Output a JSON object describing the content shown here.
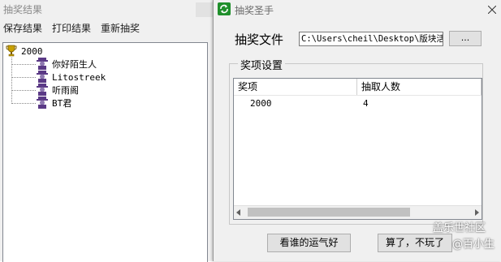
{
  "left_window": {
    "title": "抽奖结果",
    "menu": [
      "保存结果",
      "打印结果",
      "重新抽奖"
    ],
    "tree": {
      "root": "2000",
      "items": [
        "你好陌生人",
        "Litostreek",
        "听雨阁",
        "BT君"
      ]
    }
  },
  "right_window": {
    "title": "抽奖圣手",
    "file_label": "抽奖文件",
    "file_path": "C:\\Users\\cheil\\Desktop\\版块活动",
    "browse_label": "...",
    "group_label": "奖项设置",
    "list": {
      "columns": [
        "奖项",
        "抽取人数"
      ],
      "rows": [
        [
          "2000",
          "4"
        ]
      ]
    },
    "buttons": {
      "lucky": "看谁的运气好",
      "quit": "算了，不玩了"
    },
    "watermark": {
      "line1": "盖乐世社区",
      "line2": "@百小生"
    }
  },
  "colors": {
    "window_bg": "#f0f0f0",
    "icon_green": "#1f8f2b",
    "trophy_gold": "#c8a000",
    "avatar_purple": "#5b3a86"
  }
}
